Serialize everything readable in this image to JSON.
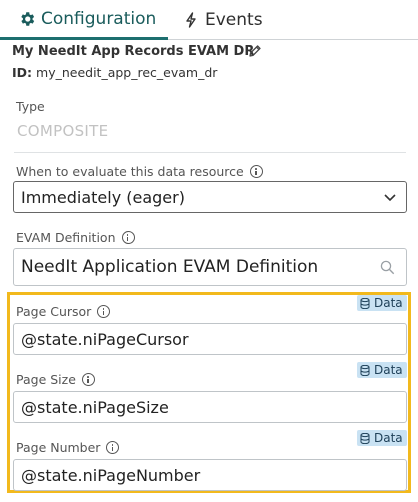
{
  "tabs": [
    {
      "label": "Configuration",
      "icon": "gear-icon",
      "active": true
    },
    {
      "label": "Events",
      "icon": "lightning-icon",
      "active": false
    }
  ],
  "record": {
    "title": "My NeedIt App Records EVAM DR",
    "id_label": "ID:",
    "id_value": "my_needit_app_rec_evam_dr"
  },
  "type": {
    "label": "Type",
    "value": "COMPOSITE"
  },
  "evaluate": {
    "label": "When to evaluate this data resource",
    "value": "Immediately (eager)"
  },
  "evam": {
    "label": "EVAM Definition",
    "value": "NeedIt Application EVAM Definition"
  },
  "properties": [
    {
      "label": "Page Cursor",
      "value": "@state.niPageCursor",
      "badge": "Data"
    },
    {
      "label": "Page Size",
      "value": "@state.niPageSize",
      "badge": "Data"
    },
    {
      "label": "Page Number",
      "value": "@state.niPageNumber",
      "badge": "Data"
    }
  ],
  "colors": {
    "accent": "#1d6f6f",
    "highlight": "#f2b91d",
    "badge_bg": "#c9e2f3"
  }
}
